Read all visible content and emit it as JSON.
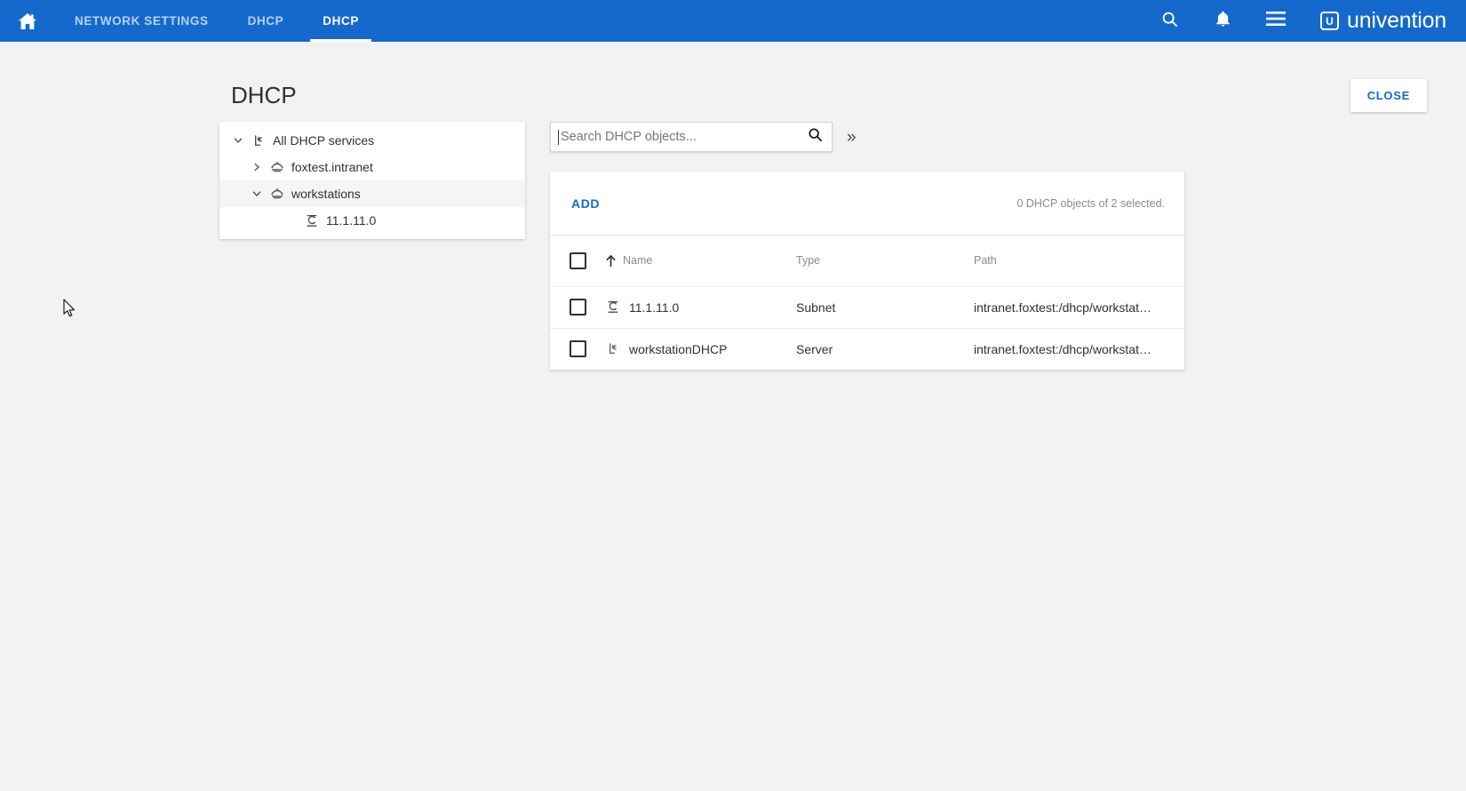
{
  "appbar": {
    "home_icon": "home-icon",
    "tabs": [
      {
        "label": "NETWORK SETTINGS",
        "active": false
      },
      {
        "label": "DHCP",
        "active": false
      },
      {
        "label": "DHCP",
        "active": true
      }
    ],
    "search_icon": "search-icon",
    "notifications_icon": "bell-icon",
    "menu_icon": "hamburger-menu-icon",
    "brand_mark": "U",
    "brand_text": "univention",
    "accent_color": "#1569cd"
  },
  "page": {
    "title": "DHCP",
    "close_label": "CLOSE"
  },
  "tree": {
    "items": [
      {
        "label": "All DHCP services",
        "icon": "dhcp-service-icon",
        "twisty": "chevron-down-icon",
        "indent": 0,
        "selected": false
      },
      {
        "label": "foxtest.intranet",
        "icon": "dhcp-server-icon",
        "twisty": "chevron-right-icon",
        "indent": 1,
        "selected": false
      },
      {
        "label": "workstations",
        "icon": "dhcp-server-icon",
        "twisty": "chevron-down-icon",
        "indent": 1,
        "selected": true
      },
      {
        "label": "11.1.11.0",
        "icon": "dhcp-subnet-icon",
        "twisty": "",
        "indent": 2,
        "selected": false
      }
    ]
  },
  "search": {
    "value": "",
    "placeholder": "Search DHCP objects...",
    "submit_icon": "search-icon",
    "expand_icon": "double-chevron-right-icon"
  },
  "grid": {
    "add_label": "ADD",
    "status": "0 DHCP objects of 2 selected.",
    "columns": [
      {
        "label": "Name",
        "sort": "ascending"
      },
      {
        "label": "Type",
        "sort": ""
      },
      {
        "label": "Path",
        "sort": ""
      }
    ],
    "rows": [
      {
        "checked": false,
        "icon": "dhcp-subnet-icon",
        "name": "11.1.11.0",
        "type": "Subnet",
        "path": "intranet.foxtest:/dhcp/workstat…"
      },
      {
        "checked": false,
        "icon": "dhcp-service-icon",
        "name": "workstationDHCP",
        "type": "Server",
        "path": "intranet.foxtest:/dhcp/workstat…"
      }
    ]
  },
  "cursor": {
    "icon": "mouse-pointer-icon"
  }
}
